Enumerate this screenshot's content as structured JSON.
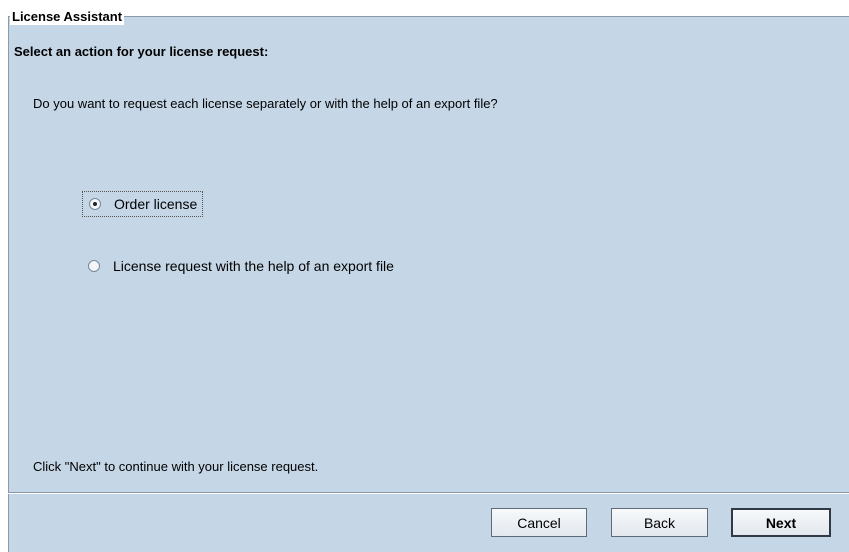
{
  "group": {
    "title": "License Assistant"
  },
  "main": {
    "heading": "Select an action for your license request:",
    "question": "Do you want to request each license separately or with the help of an export file?",
    "options": [
      {
        "label": "Order license",
        "selected": true
      },
      {
        "label": "License request with the help of an export file",
        "selected": false
      }
    ],
    "hint": "Click \"Next\" to continue with your license request."
  },
  "buttons": {
    "cancel": "Cancel",
    "back": "Back",
    "next": "Next"
  },
  "colors": {
    "panel_background": "#c5d6e6",
    "border": "#8a9aa9"
  },
  "icons": {
    "radio_selected": "radio-selected-icon",
    "radio_unselected": "radio-unselected-icon"
  }
}
